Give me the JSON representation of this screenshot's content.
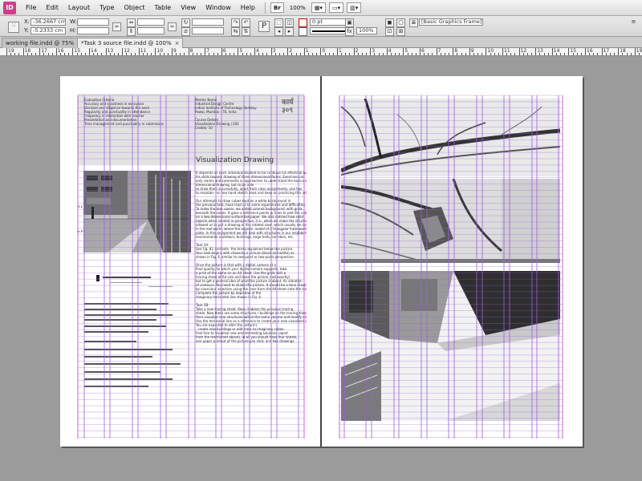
{
  "app": {
    "logo_text": "ID"
  },
  "menu": [
    "File",
    "Edit",
    "Layout",
    "Type",
    "Object",
    "Table",
    "View",
    "Window",
    "Help"
  ],
  "menubar_extra": {
    "br_badge": "Br",
    "zoom": "100%"
  },
  "control_panel": {
    "x_label": "X:",
    "x_value": "-36.2667 cm",
    "y_label": "Y:",
    "y_value": "-5.2333 cm",
    "w_label": "W:",
    "w_value": "",
    "h_label": "H:",
    "h_value": "",
    "stroke_weight": "0 pt",
    "opacity": "100%",
    "object_style": "[Basic Graphics Frame]+"
  },
  "tabs": [
    {
      "label": "working file.indd @ 75%",
      "close": "×",
      "active": false
    },
    {
      "label": "*Task 3 source file.indd @ 100%",
      "close": "×",
      "active": true
    }
  ],
  "ruler": {
    "numbers": [
      "19",
      "18",
      "17",
      "16",
      "15",
      "14",
      "13",
      "12",
      "11",
      "10",
      "9",
      "8",
      "7",
      "6",
      "5",
      "4",
      "3",
      "2",
      "1",
      "0",
      "1",
      "2",
      "3",
      "4",
      "5",
      "6",
      "7",
      "8",
      "9",
      "10",
      "11",
      "12",
      "13",
      "14",
      "15",
      "16",
      "17",
      "18",
      "19"
    ]
  },
  "left_page": {
    "criteria_text": "Evaluation Criteria\nAccuracy and exactness in execution\nDecision and diligence towards the work\nRegularity and punctuality in attendance\nFrequency in interaction with teacher\nPresentation and documentation\nTime management and punctuality in submission",
    "info_text": "Mentor Name\nIndustrial Design Centre\nIndian Institute of Technology Bombay\nPowai, Mumbai - 76, India\n\nCourse Details\nVisualization Drawing | 202\nCredits: 10",
    "deva_logo": "कार्य ३०९",
    "title": "Visualization Drawing",
    "hl_label": "H.L",
    "gp_label": "G.P",
    "body_text": "It depends on each individual student to be continue his efforts to hone\nhis skills toward  drawing of three dimensional forms. Exercises can\nonly claims and comments or approaches to understand the basics of 3\ndimensional drawing, but to be able\nto draw them successfully, apart from class assignments, one has\nto maintain his free hand sketch book and keep on practicing this art.\n\nOur attempts to draw cubes kept on a white background in\nthe previous task, have lead us to some experiences and difficulties.\nTo make the task easier, we added colored background, with grids\nbeneath the cubes. It gave a reference points or lines to plot the cubes\non a two dimensional surface like paper. We also noticed how solid\nobjects when rotated in perspective, (i.e., when we make the structure rotated\nallowed us to put a drawing of the rotated view, which usually we don't happen\nin the real world, where the objects  model of a triangular framework, like\nplate. In this assignment we will deal with structures in our neighboring\nenvironments (outdoors, buildings, large halls, corridors, etc.\n\nTask 3A:\nSee Fig. 81 and note  the terms explained below the picture.\nYour task begins with choosing a picture (black and white) as\nshown in Fig. 4, similar to one-point or two-point perspective.\n\nOnce the picture is that with a digital camera at a\nfinal quality, to which your digital camera supports, take\na print of the same on an A4 sheet. Use the grids with a\ntracing sheet of A4 size and trace the picture (not exactly)\nbut to get a general idea of what the picture is about, its vibration\nof contours. You need to shade the picture. It should be a tone drawing\nby conscious selection using the lines from the A4 sheet onto the tracing.\nComplete the picture by depiction of the\nimaginary horizontal line shown in Fig. 4.\n\nTask 3B:\nTake a new tracing sheet. Keep it above the previous tracing\nsheet. Now there are some structures / buildings on the tracing sheet and\nthen visualize new structures within the same volume and modify alone.\nUse the horizontal line as a reference to create your new visualized picture.\nYou are expected to alter the picture's\n  create new buildings or add trees to imaginary cubes.\nFeel free to visualize new and interesting solutions (apart\nfrom the mentioned above). In all you should have four sheets,\none paper printout of the picture you shot, and two drawings."
  },
  "colors": {
    "guide": "#9b5fe0",
    "margin": "#c23ad6",
    "pasteboard": "#9b9b9b",
    "page": "#ffffff",
    "block": "#e2e2e2"
  }
}
